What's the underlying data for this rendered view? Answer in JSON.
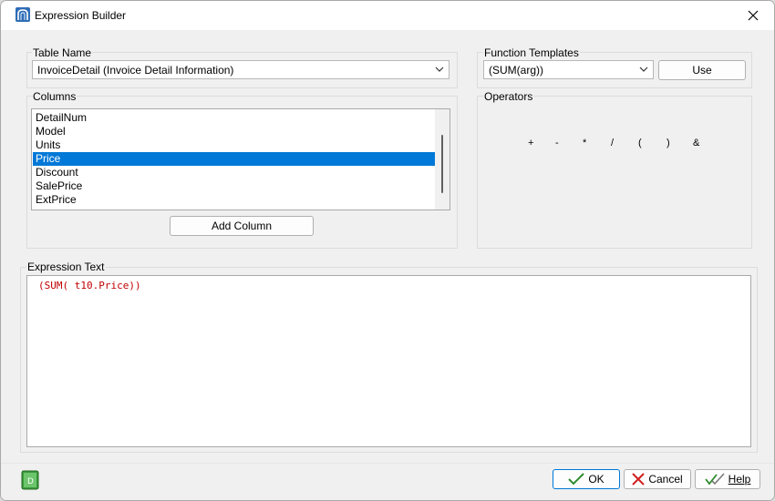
{
  "window": {
    "title": "Expression Builder"
  },
  "table_name": {
    "label": "Table Name",
    "selected": "InvoiceDetail  (Invoice Detail Information)"
  },
  "columns": {
    "label": "Columns",
    "items": [
      "DetailNum",
      "Model",
      "Units",
      "Price",
      "Discount",
      "SalePrice",
      "ExtPrice"
    ],
    "selected_index": 3,
    "add_button": "Add Column"
  },
  "function_templates": {
    "label": "Function Templates",
    "selected": "(SUM(arg))",
    "use_button": "Use"
  },
  "operators": {
    "label": "Operators",
    "items": [
      "+",
      "-",
      "*",
      "/",
      "(",
      ")",
      "&"
    ]
  },
  "expression": {
    "label": "Expression Text",
    "text": "(SUM( t10.Price))"
  },
  "footer": {
    "ok": "OK",
    "cancel": "Cancel",
    "help": "Help"
  },
  "colors": {
    "selection": "#0078d7",
    "expression_text": "#c00000",
    "ok_border": "#0078d7",
    "check_green": "#2e8b2e",
    "cancel_red": "#d22020"
  }
}
